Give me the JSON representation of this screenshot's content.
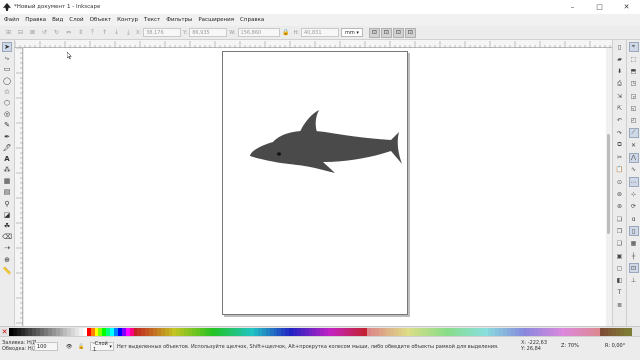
{
  "window": {
    "title": "*Новый документ 1 - Inkscape",
    "controls": [
      "–",
      "□",
      "✕"
    ]
  },
  "menu": [
    "Файл",
    "Правка",
    "Вид",
    "Слой",
    "Объект",
    "Контур",
    "Текст",
    "Фильтры",
    "Расширения",
    "Справка"
  ],
  "toolbar": {
    "x_label": "X:",
    "x_value": "38,176",
    "y_label": "Y:",
    "y_value": "86,935",
    "w_label": "W:",
    "w_value": "156,860",
    "h_label": "H:",
    "h_value": "40,831",
    "unit": "mm"
  },
  "status": {
    "fill_label": "Заливка:",
    "fill_value": "Н/Д",
    "stroke_label": "Обводка:",
    "stroke_value": "Н/Д",
    "opacity": "100",
    "layer": "-Слой 1",
    "message": "Нет выделенных объектов. Используйте щелчок, Shift+щелчок, Alt+прокрутка колесом мыши, либо обведите объекты рамкой для выделения.",
    "x_label": "X:",
    "x_value": "-222,63",
    "y_label": "Y:",
    "y_value": "26,84",
    "z_label": "Z:",
    "zoom": "70%",
    "r_label": "R:",
    "rotation": "0,00°"
  },
  "colors": {
    "dolphin": "#4a4a4a",
    "accent": "#cfd8e6"
  },
  "icons": {
    "tools": [
      "selector-icon",
      "node-icon",
      "rect-icon",
      "ellipse-icon",
      "star-icon",
      "3dbox-icon",
      "spiral-icon",
      "pencil-icon",
      "pen-icon",
      "calligraphy-icon",
      "text-icon",
      "spray-icon",
      "mesh-icon",
      "gradient-icon",
      "dropper-icon",
      "paintbucket-icon",
      "tweak-icon",
      "eraser-icon",
      "connector-icon",
      "zoom-icon",
      "measure-icon"
    ]
  }
}
